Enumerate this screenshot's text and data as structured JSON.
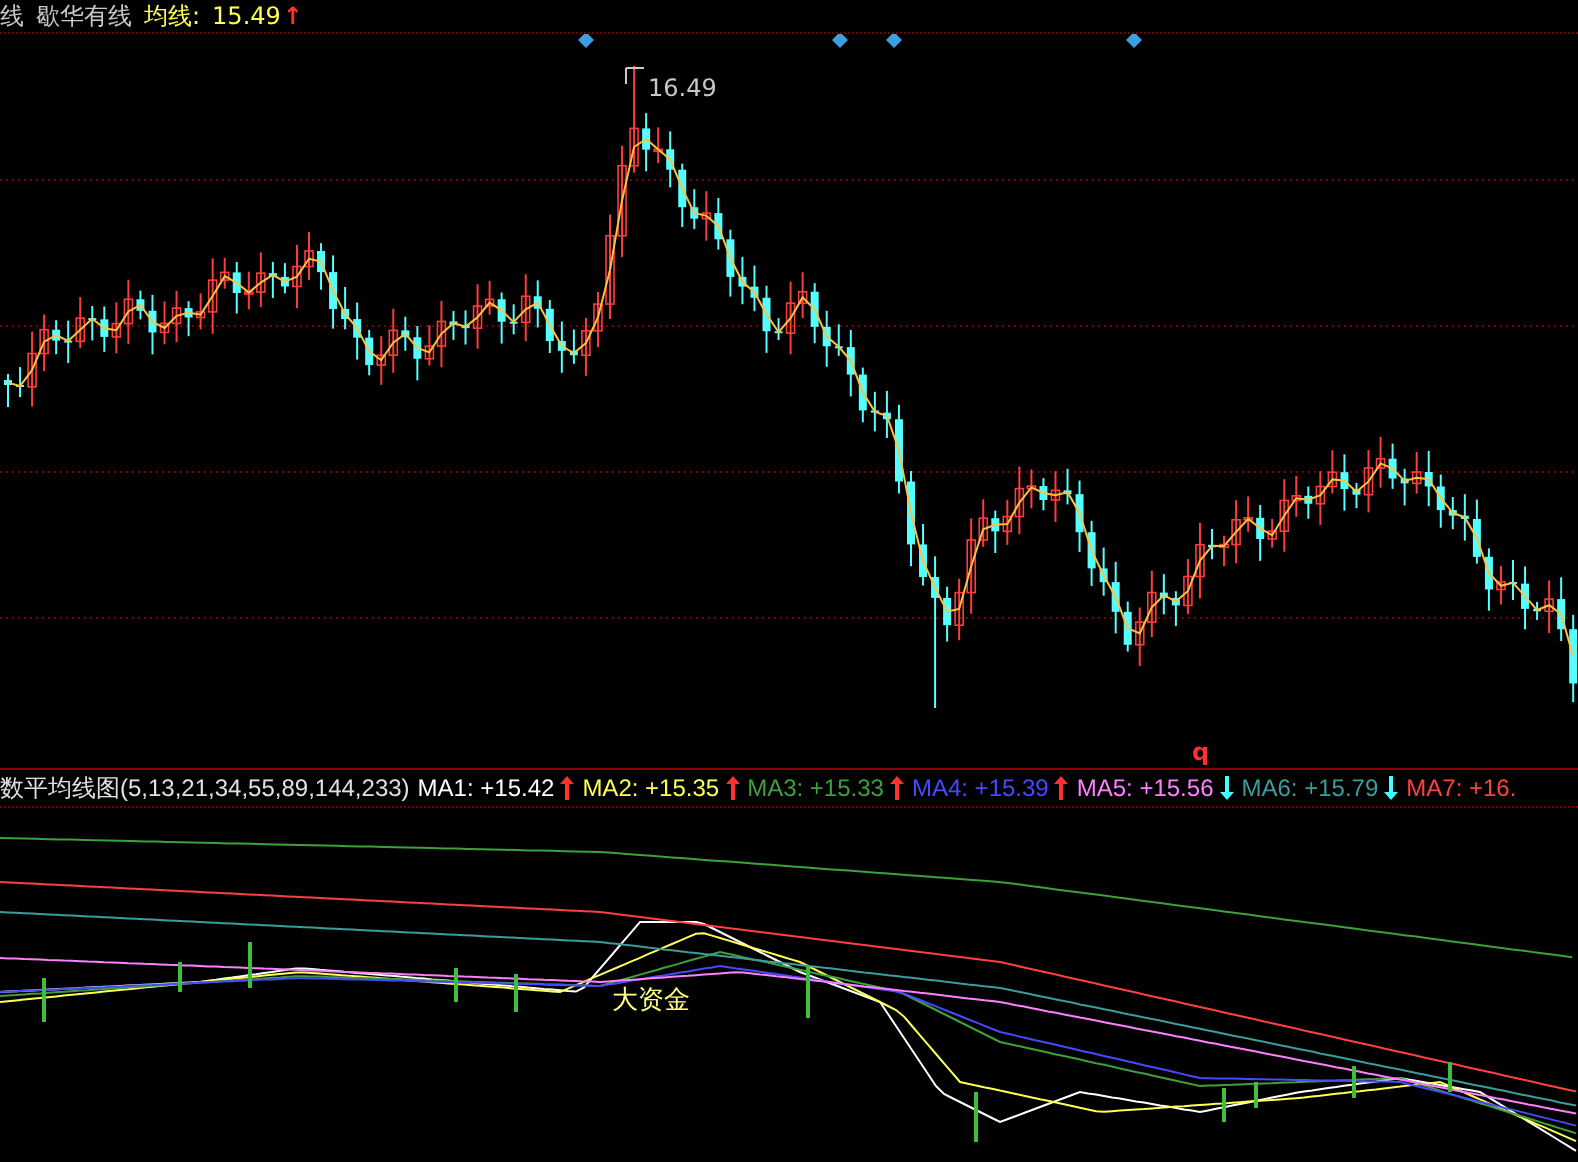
{
  "header": {
    "items": [
      {
        "text": "线",
        "kind": "plain"
      },
      {
        "text": "歇华有线",
        "kind": "plain"
      },
      {
        "text": "均线:",
        "kind": "label"
      },
      {
        "text": "15.49",
        "kind": "value"
      },
      {
        "text": "↑",
        "kind": "up"
      }
    ]
  },
  "main_chart": {
    "peak_label": "16.49",
    "marker": "q"
  },
  "indicator": {
    "title": "数平均线图(5,13,21,34,55,89,144,233)",
    "items": [
      {
        "label": "MA1:",
        "value": "+15.42",
        "kind": "up",
        "color": "#ffffff"
      },
      {
        "label": "MA2:",
        "value": "+15.35",
        "kind": "up",
        "color": "#ffff54"
      },
      {
        "label": "MA3:",
        "value": "+15.33",
        "kind": "up",
        "color": "#3ca03c"
      },
      {
        "label": "MA4:",
        "value": "+15.39",
        "kind": "up",
        "color": "#4848ff"
      },
      {
        "label": "MA5:",
        "value": "+15.56",
        "kind": "down",
        "color": "#ff80ff"
      },
      {
        "label": "MA6:",
        "value": "+15.79",
        "kind": "down",
        "color": "#3c9c9c"
      },
      {
        "label": "MA7:",
        "value": "+16.",
        "color": "#ff4040"
      }
    ],
    "annotation": "大资金"
  }
}
